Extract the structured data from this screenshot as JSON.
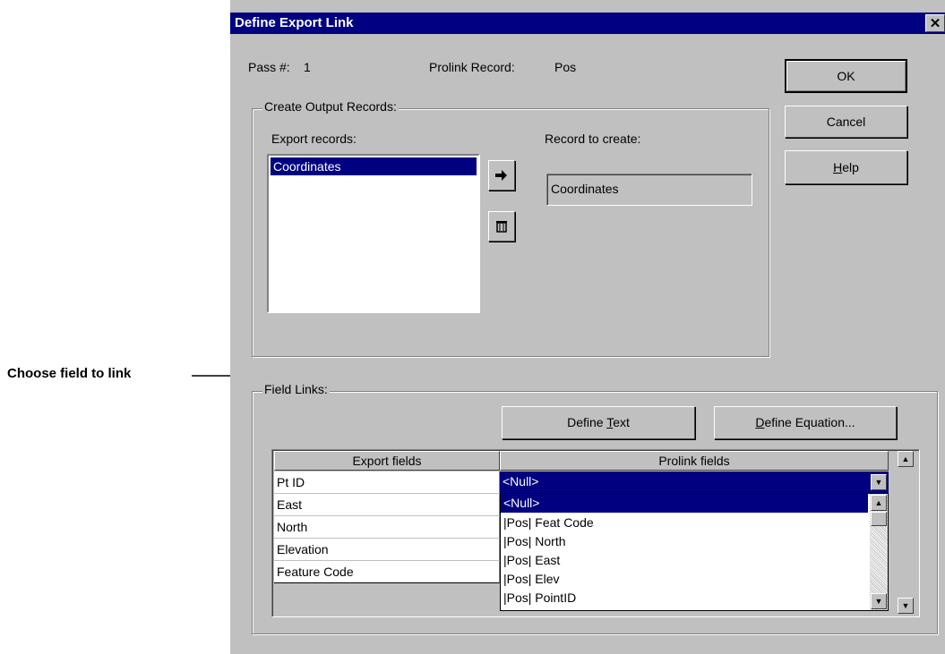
{
  "callout": {
    "label": "Choose field to link"
  },
  "dialog": {
    "title": "Define Export Link",
    "close_glyph": "✕",
    "pass_label": "Pass #:",
    "pass_value": "1",
    "prolink_record_label": "Prolink Record:",
    "prolink_record_value": "Pos",
    "buttons": {
      "ok": "OK",
      "cancel": "Cancel",
      "help_prefix": "",
      "help_underline": "H",
      "help_rest": "elp"
    },
    "output_records": {
      "group_label": "Create Output Records:",
      "export_records_label": "Export records:",
      "export_records": [
        "Coordinates"
      ],
      "record_to_create_label": "Record to create:",
      "record_to_create_value": "Coordinates"
    },
    "field_links": {
      "group_label": "Field Links:",
      "define_text": {
        "prefix": "Define ",
        "underline": "T",
        "rest": "ext"
      },
      "define_equation": {
        "prefix": "",
        "underline": "D",
        "rest": "efine Equation..."
      },
      "columns": [
        "Export fields",
        "Prolink fields"
      ],
      "export_fields": [
        "Pt ID",
        "East",
        "North",
        "Elevation",
        "Feature Code"
      ],
      "combo_value": "<Null>",
      "dropdown_options": [
        "<Null>",
        "|Pos|  Feat Code",
        "|Pos|  North",
        "|Pos|  East",
        "|Pos|  Elev",
        "|Pos|  PointID"
      ]
    }
  }
}
